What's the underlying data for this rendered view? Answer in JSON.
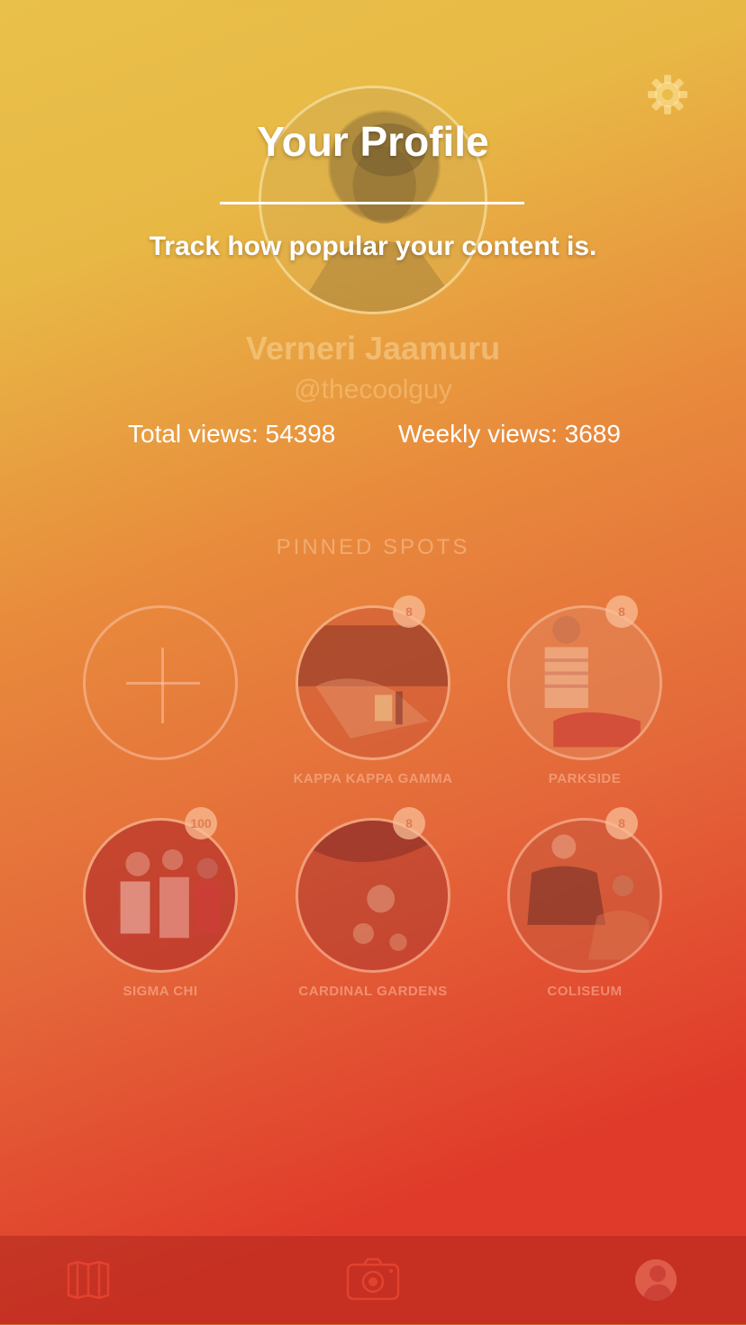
{
  "header": {
    "title": "Your Profile",
    "subtitle": "Track how popular your content is."
  },
  "user": {
    "name": "Verneri Jaamuru",
    "handle": "@thecoolguy"
  },
  "stats": {
    "total_views": "Total views: 54398",
    "weekly_views": "Weekly views: 3689"
  },
  "pinned": {
    "title": "PINNED SPOTS",
    "spots": [
      {
        "label": "KAPPA KAPPA GAMMA",
        "count": "8"
      },
      {
        "label": "PARKSIDE",
        "count": "8"
      },
      {
        "label": "SIGMA CHI",
        "count": "100"
      },
      {
        "label": "CARDINAL GARDENS",
        "count": "8"
      },
      {
        "label": "COLISEUM",
        "count": "8"
      }
    ]
  },
  "icons": {
    "settings": "gear-icon",
    "add": "plus-icon",
    "map_tab": "map-icon",
    "camera_tab": "camera-icon",
    "profile_tab": "profile-avatar-icon"
  },
  "colors": {
    "gradient_top": "#e9c04a",
    "gradient_bottom": "#df3a2a",
    "tabbar": "#b8342a"
  }
}
